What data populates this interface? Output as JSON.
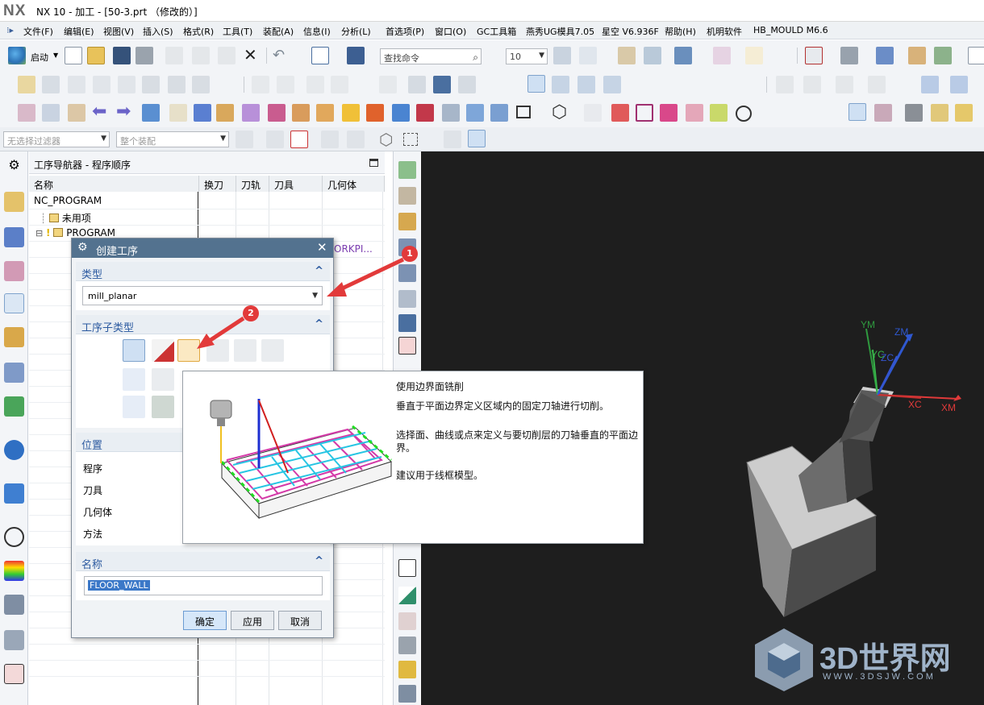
{
  "window": {
    "logo": "NX",
    "title": "NX 10 - 加工 - [50-3.prt （修改的）]"
  },
  "menu": [
    "文件(F)",
    "编辑(E)",
    "视图(V)",
    "插入(S)",
    "格式(R)",
    "工具(T)",
    "装配(A)",
    "信息(I)",
    "分析(L)",
    "首选项(P)",
    "窗口(O)",
    "GC工具箱",
    "燕秀UG模具7.05",
    "星空 V6.936F",
    "帮助(H)",
    "机明软件",
    "HB_MOULD M6.6"
  ],
  "toolbar": {
    "start_label": "启动",
    "search_placeholder": "查找命令",
    "layer_value": "10",
    "filter_value": "无选择过滤器",
    "assembly_value": "整个装配"
  },
  "navigator": {
    "title": "工序导航器 - 程序顺序",
    "columns": [
      "名称",
      "换刀",
      "刀轨",
      "刀具",
      "几何体"
    ],
    "rows": [
      {
        "name": "NC_PROGRAM"
      },
      {
        "name": "未用项"
      },
      {
        "name": "PROGRAM"
      }
    ],
    "partial_geometry": "ORKPI..."
  },
  "dialog": {
    "title": "创建工序",
    "type_header": "类型",
    "type_value": "mill_planar",
    "subtype_header": "工序子类型",
    "location_header": "位置",
    "location_labels": [
      "程序",
      "刀具",
      "几何体",
      "方法"
    ],
    "name_header": "名称",
    "name_value": "FLOOR_WALL",
    "buttons": {
      "ok": "确定",
      "apply": "应用",
      "cancel": "取消"
    }
  },
  "tooltip": {
    "title": "使用边界面铣削",
    "line1": "垂直于平面边界定义区域内的固定刀轴进行切削。",
    "line2a": "选择面、曲线或点来定义与要切削层的刀轴垂直的平面边",
    "line2b": "界。",
    "line3": "建议用于线框模型。"
  },
  "annotations": {
    "badge1": "1",
    "badge2": "2"
  },
  "axes": {
    "ym": "YM",
    "zm": "ZM",
    "yc": "YC",
    "zc": "ZC",
    "xc": "XC",
    "xm": "XM"
  },
  "watermark": {
    "brand": "3D世界网",
    "url": "W W W . 3 D S J W . C O M"
  },
  "colors": {
    "dialog_title": "#53728f",
    "section_text": "#2c5aa0",
    "viewport": "#1e1e1e",
    "annotation_red": "#e23a3a"
  }
}
